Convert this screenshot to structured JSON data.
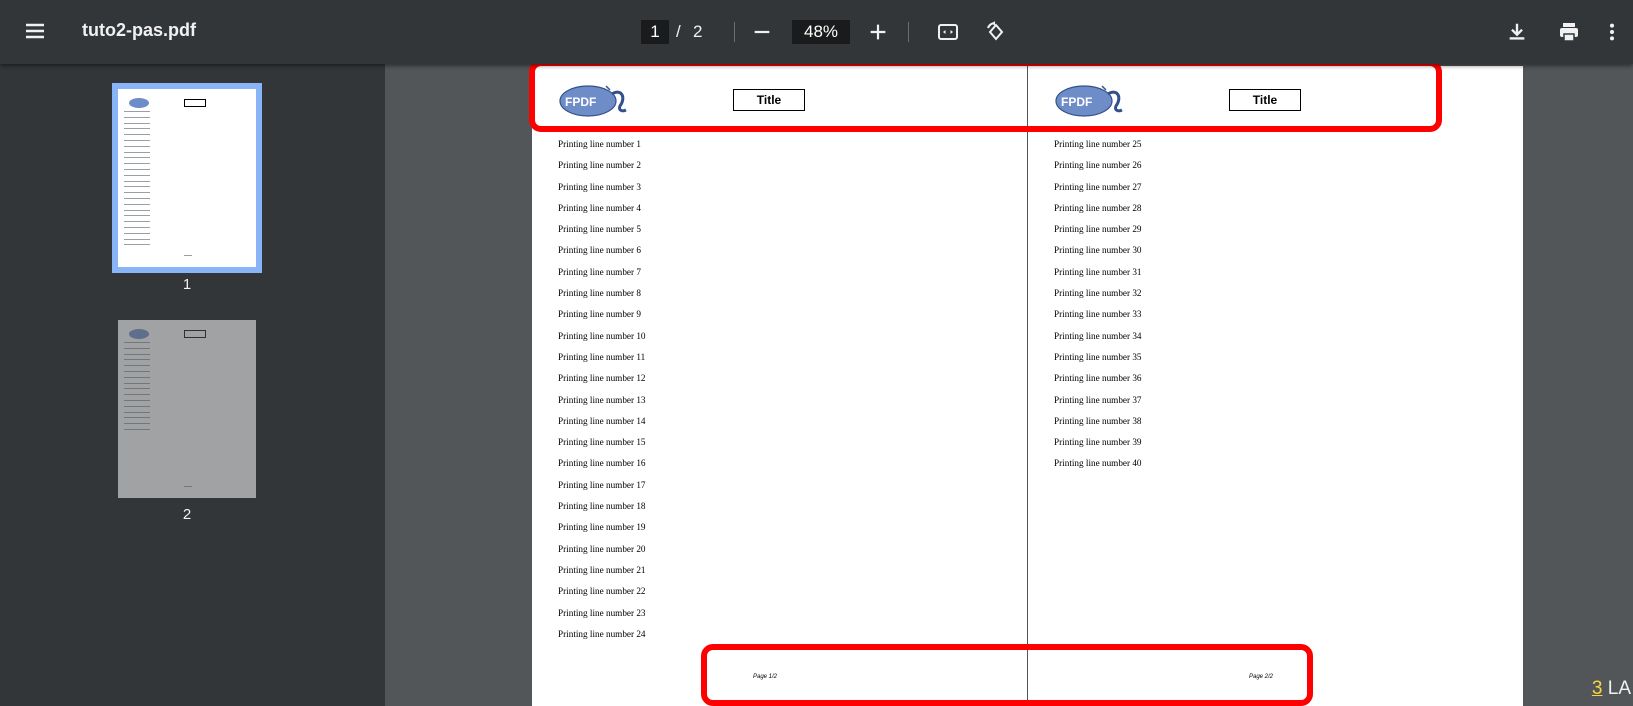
{
  "toolbar": {
    "file_title": "tuto2-pas.pdf",
    "current_page": "1",
    "page_separator": "/",
    "total_pages": "2",
    "zoom_level": "48%"
  },
  "thumbnails": [
    {
      "label": "1"
    },
    {
      "label": "2"
    }
  ],
  "document": {
    "logo_text": "FPDF",
    "pages": [
      {
        "title": "Title",
        "footer": "Page 1/2",
        "lines": [
          "Printing line number 1",
          "Printing line number 2",
          "Printing line number 3",
          "Printing line number 4",
          "Printing line number 5",
          "Printing line number 6",
          "Printing line number 7",
          "Printing line number 8",
          "Printing line number 9",
          "Printing line number 10",
          "Printing line number 11",
          "Printing line number 12",
          "Printing line number 13",
          "Printing line number 14",
          "Printing line number 15",
          "Printing line number 16",
          "Printing line number 17",
          "Printing line number 18",
          "Printing line number 19",
          "Printing line number 20",
          "Printing line number 21",
          "Printing line number 22",
          "Printing line number 23",
          "Printing line number 24"
        ]
      },
      {
        "title": "Title",
        "footer": "Page 2/2",
        "lines": [
          "Printing line number 25",
          "Printing line number 26",
          "Printing line number 27",
          "Printing line number 28",
          "Printing line number 29",
          "Printing line number 30",
          "Printing line number 31",
          "Printing line number 32",
          "Printing line number 33",
          "Printing line number 34",
          "Printing line number 35",
          "Printing line number 36",
          "Printing line number 37",
          "Printing line number 38",
          "Printing line number 39",
          "Printing line number 40"
        ]
      }
    ]
  },
  "overlay": {
    "corner_number": "3",
    "corner_text": "LA"
  },
  "colors": {
    "toolbar_bg": "#323639",
    "viewer_bg": "#525659",
    "selection": "#8ab4f8",
    "highlight": "#ff0000"
  }
}
